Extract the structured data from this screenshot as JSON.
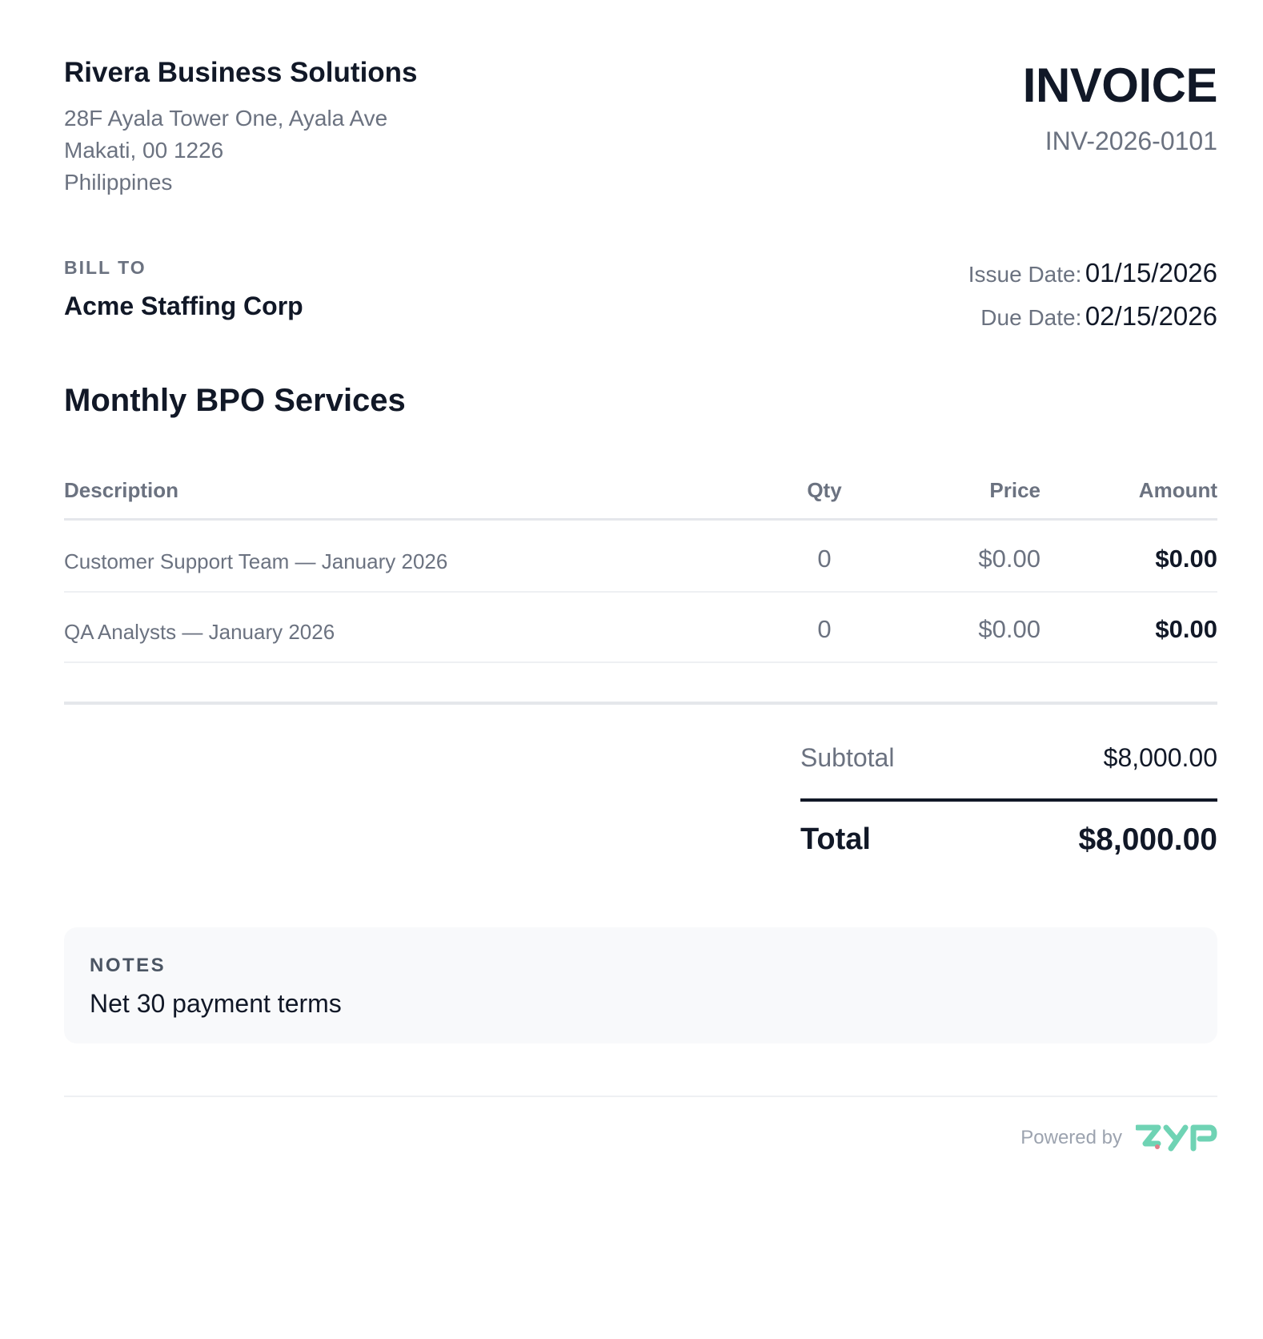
{
  "company": {
    "name": "Rivera Business Solutions",
    "address": [
      "28F Ayala Tower One, Ayala Ave",
      "Makati, 00 1226",
      "Philippines"
    ]
  },
  "invoice": {
    "title": "INVOICE",
    "number": "INV-2026-0101"
  },
  "bill_to": {
    "label": "BILL TO",
    "name": "Acme Staffing Corp"
  },
  "dates": {
    "issue_label": "Issue Date:",
    "issue_value": "01/15/2026",
    "due_label": "Due Date:",
    "due_value": "02/15/2026"
  },
  "section_title": "Monthly BPO Services",
  "table": {
    "headers": {
      "description": "Description",
      "qty": "Qty",
      "price": "Price",
      "amount": "Amount"
    },
    "rows": [
      {
        "description": "Customer Support Team — January 2026",
        "qty": "0",
        "price": "$0.00",
        "amount": "$0.00"
      },
      {
        "description": "QA Analysts — January 2026",
        "qty": "0",
        "price": "$0.00",
        "amount": "$0.00"
      }
    ]
  },
  "totals": {
    "subtotal_label": "Subtotal",
    "subtotal_value": "$8,000.00",
    "total_label": "Total",
    "total_value": "$8,000.00"
  },
  "notes": {
    "label": "NOTES",
    "text": "Net 30 payment terms"
  },
  "footer": {
    "powered_by": "Powered by",
    "brand_logo": "ZYP",
    "brand_color": "#6fd3b4"
  }
}
